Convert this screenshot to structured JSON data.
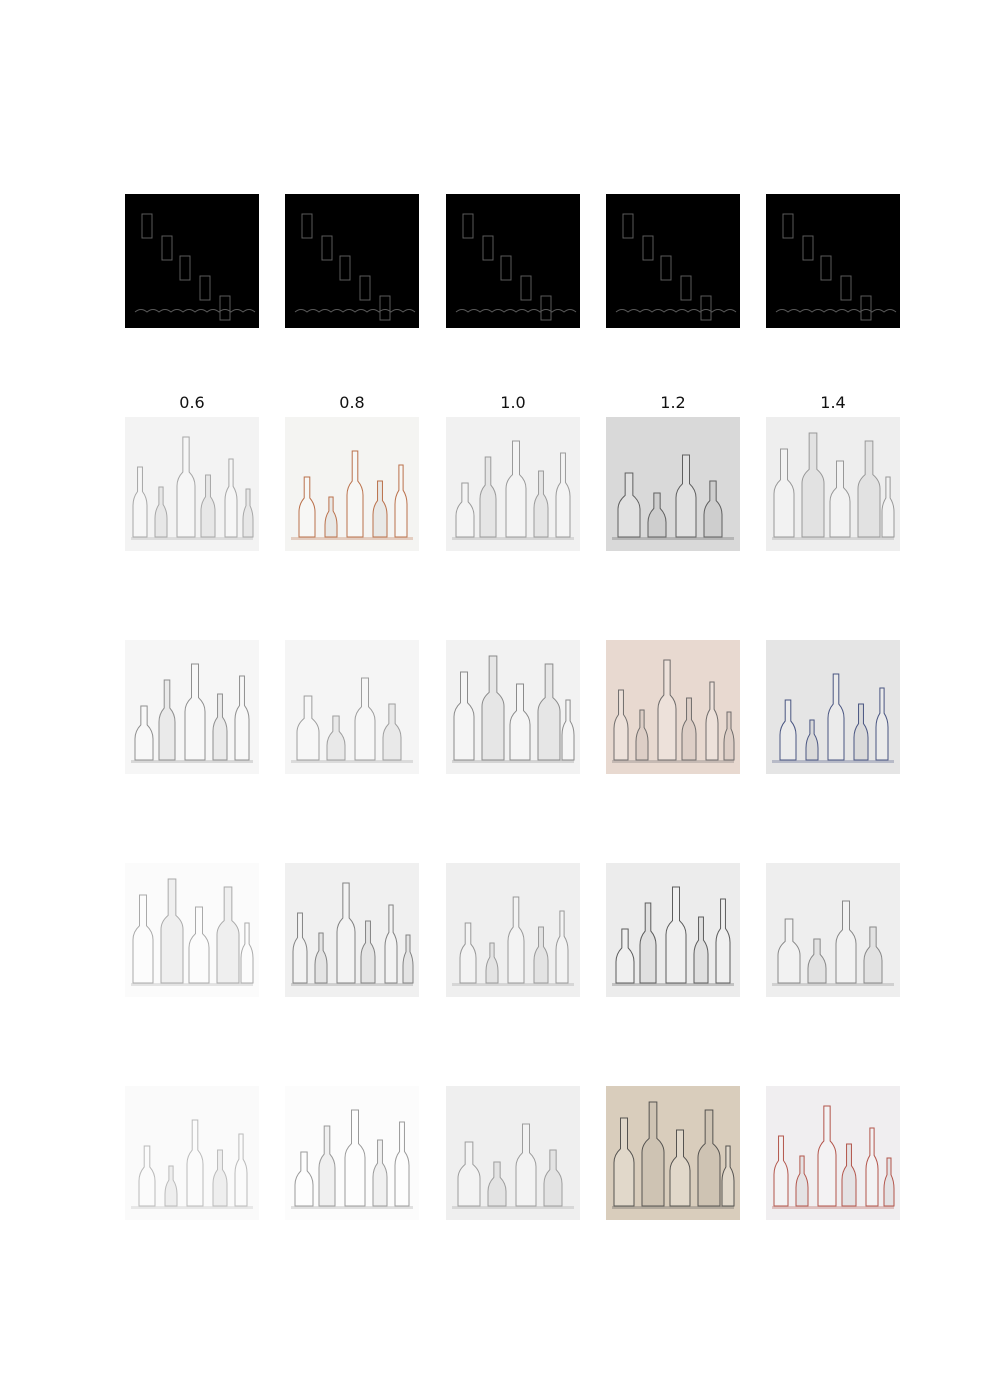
{
  "column_labels": [
    "0.6",
    "0.8",
    "1.0",
    "1.2",
    "1.4"
  ],
  "grid": {
    "conditioning_row": {
      "kind": "edge-map",
      "tiles": [
        "edge-map",
        "edge-map",
        "edge-map",
        "edge-map",
        "edge-map"
      ]
    },
    "sample_rows": [
      [
        {
          "kind": "sketch",
          "bg": "#f3f3f3",
          "tint": "#9a9a9a"
        },
        {
          "kind": "sketch",
          "bg": "#f4f4f2",
          "tint": "#b0592d"
        },
        {
          "kind": "sketch",
          "bg": "#f1f1f1",
          "tint": "#8c8c8c"
        },
        {
          "kind": "sketch",
          "bg": "#d9d9d9",
          "tint": "#4a4a4a"
        },
        {
          "kind": "sketch",
          "bg": "#eeeeee",
          "tint": "#8a8a8a"
        }
      ],
      [
        {
          "kind": "sketch",
          "bg": "#f6f6f6",
          "tint": "#7e7e7e"
        },
        {
          "kind": "sketch",
          "bg": "#f5f5f5",
          "tint": "#8f8f8f"
        },
        {
          "kind": "sketch",
          "bg": "#f2f2f2",
          "tint": "#7a7a7a"
        },
        {
          "kind": "sketch",
          "bg": "#e8d9d0",
          "tint": "#5a5a5a"
        },
        {
          "kind": "sketch",
          "bg": "#e5e5e5",
          "tint": "#2e3c70"
        }
      ],
      [
        {
          "kind": "sketch",
          "bg": "#fbfbfb",
          "tint": "#9d9d9d"
        },
        {
          "kind": "sketch",
          "bg": "#f0f0f0",
          "tint": "#6f6f6f"
        },
        {
          "kind": "sketch",
          "bg": "#efefef",
          "tint": "#8a8a8a"
        },
        {
          "kind": "sketch",
          "bg": "#ececec",
          "tint": "#444444"
        },
        {
          "kind": "sketch",
          "bg": "#eeeeee",
          "tint": "#777777"
        }
      ],
      [
        {
          "kind": "sketch",
          "bg": "#fafafa",
          "tint": "#b0b0b0"
        },
        {
          "kind": "sketch",
          "bg": "#fcfcfc",
          "tint": "#8a8a8a"
        },
        {
          "kind": "sketch",
          "bg": "#efefef",
          "tint": "#8f8f8f"
        },
        {
          "kind": "sketch",
          "bg": "#d9cdbc",
          "tint": "#3e3e3e"
        },
        {
          "kind": "sketch",
          "bg": "#f0eef0",
          "tint": "#a83a2e"
        }
      ]
    ]
  }
}
